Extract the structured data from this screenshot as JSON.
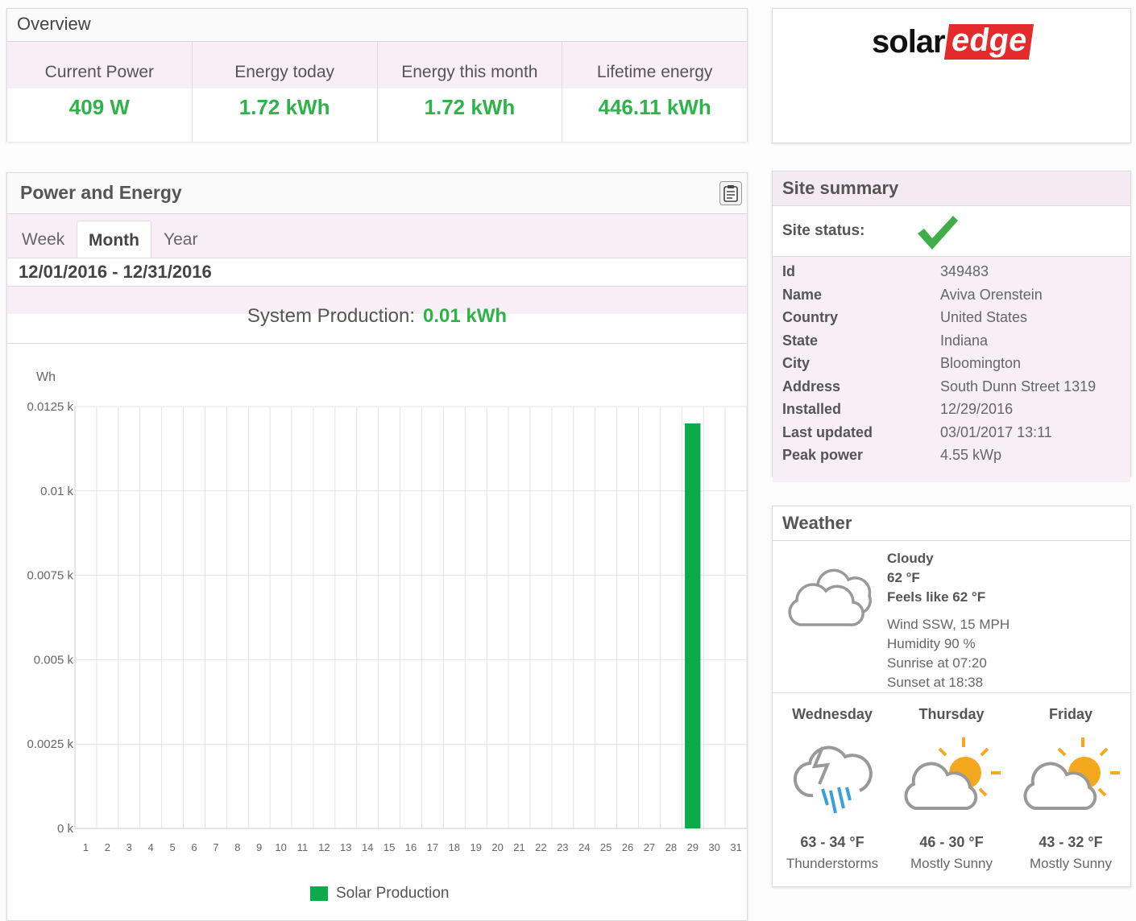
{
  "overview": {
    "title": "Overview",
    "cells": [
      {
        "label": "Current Power",
        "value": "409 W"
      },
      {
        "label": "Energy today",
        "value": "1.72 kWh"
      },
      {
        "label": "Energy this month",
        "value": "1.72 kWh"
      },
      {
        "label": "Lifetime energy",
        "value": "446.11 kWh"
      }
    ]
  },
  "logo": {
    "solar": "solar",
    "edge": "edge"
  },
  "power_energy": {
    "title": "Power and Energy",
    "tabs": [
      {
        "label": "Week"
      },
      {
        "label": "Month"
      },
      {
        "label": "Year"
      }
    ],
    "active_tab": "Month",
    "date_range": "12/01/2016 - 12/31/2016",
    "system_production_label": "System Production:",
    "system_production_value": "0.01 kWh",
    "legend_label": "Solar Production"
  },
  "chart_data": {
    "type": "bar",
    "categories": [
      "1",
      "2",
      "3",
      "4",
      "5",
      "6",
      "7",
      "8",
      "9",
      "10",
      "11",
      "12",
      "13",
      "14",
      "15",
      "16",
      "17",
      "18",
      "19",
      "20",
      "21",
      "22",
      "23",
      "24",
      "25",
      "26",
      "27",
      "28",
      "29",
      "30",
      "31"
    ],
    "series": [
      {
        "name": "Solar Production",
        "values": [
          0,
          0,
          0,
          0,
          0,
          0,
          0,
          0,
          0,
          0,
          0,
          0,
          0,
          0,
          0,
          0,
          0,
          0,
          0,
          0,
          0,
          0,
          0,
          0,
          0,
          0,
          0,
          0,
          0.012,
          0,
          0
        ],
        "color": "#0bab4b"
      }
    ],
    "ylabel": "Wh",
    "yticks": [
      "0 k",
      "0.0025 k",
      "0.005 k",
      "0.0075 k",
      "0.01 k",
      "0.0125 k"
    ],
    "ytick_values": [
      0,
      0.0025,
      0.005,
      0.0075,
      0.01,
      0.0125
    ],
    "ylim": [
      0,
      0.0125
    ],
    "grid": true,
    "legend": "bottom"
  },
  "site_summary": {
    "title": "Site summary",
    "status_label": "Site status:",
    "rows": [
      {
        "key": "Id",
        "value": "349483"
      },
      {
        "key": "Name",
        "value": "Aviva Orenstein"
      },
      {
        "key": "Country",
        "value": "United States"
      },
      {
        "key": "State",
        "value": "Indiana"
      },
      {
        "key": "City",
        "value": "Bloomington"
      },
      {
        "key": "Address",
        "value": "South Dunn Street 1319"
      },
      {
        "key": "Installed",
        "value": "12/29/2016"
      },
      {
        "key": "Last updated",
        "value": "03/01/2017 13:11"
      },
      {
        "key": "Peak power",
        "value": "4.55 kWp"
      }
    ]
  },
  "weather": {
    "title": "Weather",
    "current": {
      "condition": "Cloudy",
      "temp": "62 °F",
      "feels_like": "Feels like 62 °F",
      "wind": "Wind SSW, 15 MPH",
      "humidity": "Humidity 90 %",
      "sunrise": "Sunrise at 07:20",
      "sunset": "Sunset at 18:38",
      "icon": "cloud-icon"
    },
    "forecast": [
      {
        "day": "Wednesday",
        "temp": "63 - 34 °F",
        "desc": "Thunderstorms",
        "icon": "thunderstorm-icon"
      },
      {
        "day": "Thursday",
        "temp": "46 - 30 °F",
        "desc": "Mostly Sunny",
        "icon": "partly-sunny-icon"
      },
      {
        "day": "Friday",
        "temp": "43 - 32 °F",
        "desc": "Mostly Sunny",
        "icon": "partly-sunny-icon"
      }
    ]
  },
  "colors": {
    "accent_green": "#2db34a",
    "bar_green": "#0bab4b",
    "pink_band": "#f7eef6",
    "brand_red": "#e32b2b"
  }
}
